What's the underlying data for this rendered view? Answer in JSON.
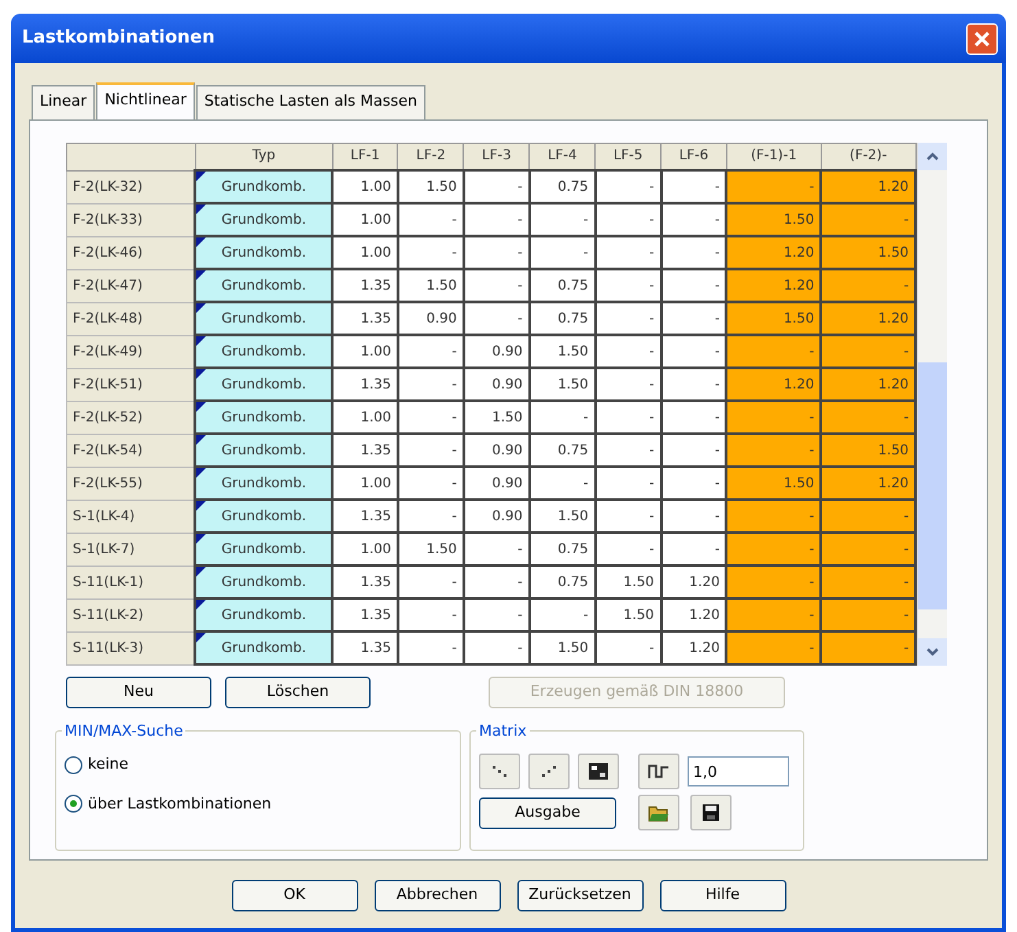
{
  "window": {
    "title": "Lastkombinationen"
  },
  "tabs": [
    {
      "label": "Linear",
      "selected": false
    },
    {
      "label": "Nichtlinear",
      "selected": true
    },
    {
      "label": "Statische Lasten als Massen",
      "selected": false
    }
  ],
  "table": {
    "columns": [
      {
        "kind": "name"
      },
      {
        "label": "Typ",
        "kind": "type"
      },
      {
        "label": "LF-1",
        "kind": "value"
      },
      {
        "label": "LF-2",
        "kind": "value"
      },
      {
        "label": "LF-3",
        "kind": "value"
      },
      {
        "label": "LF-4",
        "kind": "value"
      },
      {
        "label": "LF-5",
        "kind": "value"
      },
      {
        "label": "LF-6",
        "kind": "value"
      },
      {
        "label": "(F-1)-1",
        "kind": "highlight"
      },
      {
        "label": "(F-2)-",
        "kind": "highlight"
      }
    ],
    "rows": [
      {
        "cells": [
          "F-2(LK-32)",
          "Grundkomb.",
          "1.00",
          "1.50",
          "-",
          "0.75",
          "-",
          "-",
          "-",
          "1.20"
        ]
      },
      {
        "cells": [
          "F-2(LK-33)",
          "Grundkomb.",
          "1.00",
          "-",
          "-",
          "-",
          "-",
          "-",
          "1.50",
          "-"
        ]
      },
      {
        "cells": [
          "F-2(LK-46)",
          "Grundkomb.",
          "1.00",
          "-",
          "-",
          "-",
          "-",
          "-",
          "1.20",
          "1.50"
        ]
      },
      {
        "cells": [
          "F-2(LK-47)",
          "Grundkomb.",
          "1.35",
          "1.50",
          "-",
          "0.75",
          "-",
          "-",
          "1.20",
          "-"
        ]
      },
      {
        "cells": [
          "F-2(LK-48)",
          "Grundkomb.",
          "1.35",
          "0.90",
          "-",
          "0.75",
          "-",
          "-",
          "1.50",
          "1.20"
        ]
      },
      {
        "cells": [
          "F-2(LK-49)",
          "Grundkomb.",
          "1.00",
          "-",
          "0.90",
          "1.50",
          "-",
          "-",
          "-",
          "-"
        ]
      },
      {
        "cells": [
          "F-2(LK-51)",
          "Grundkomb.",
          "1.35",
          "-",
          "0.90",
          "1.50",
          "-",
          "-",
          "1.20",
          "1.20"
        ]
      },
      {
        "cells": [
          "F-2(LK-52)",
          "Grundkomb.",
          "1.00",
          "-",
          "1.50",
          "-",
          "-",
          "-",
          "-",
          "-"
        ]
      },
      {
        "cells": [
          "F-2(LK-54)",
          "Grundkomb.",
          "1.35",
          "-",
          "0.90",
          "0.75",
          "-",
          "-",
          "-",
          "1.50"
        ]
      },
      {
        "cells": [
          "F-2(LK-55)",
          "Grundkomb.",
          "1.00",
          "-",
          "0.90",
          "-",
          "-",
          "-",
          "1.50",
          "1.20"
        ]
      },
      {
        "cells": [
          "S-1(LK-4)",
          "Grundkomb.",
          "1.35",
          "-",
          "0.90",
          "1.50",
          "-",
          "-",
          "-",
          "-"
        ]
      },
      {
        "cells": [
          "S-1(LK-7)",
          "Grundkomb.",
          "1.00",
          "1.50",
          "-",
          "0.75",
          "-",
          "-",
          "-",
          "-"
        ]
      },
      {
        "cells": [
          "S-11(LK-1)",
          "Grundkomb.",
          "1.35",
          "-",
          "-",
          "0.75",
          "1.50",
          "1.20",
          "-",
          "-"
        ]
      },
      {
        "cells": [
          "S-11(LK-2)",
          "Grundkomb.",
          "1.35",
          "-",
          "-",
          "-",
          "1.50",
          "1.20",
          "-",
          "-"
        ]
      },
      {
        "cells": [
          "S-11(LK-3)",
          "Grundkomb.",
          "1.35",
          "-",
          "-",
          "1.50",
          "-",
          "1.20",
          "-",
          "-"
        ]
      }
    ]
  },
  "table_buttons": [
    {
      "label": "Neu",
      "disabled": false
    },
    {
      "label": "Löschen",
      "disabled": false
    },
    {
      "label": "Erzeugen gemäß DIN 18800",
      "disabled": true
    }
  ],
  "minmax": {
    "title": "MIN/MAX-Suche",
    "options": [
      {
        "label": "keine",
        "selected": false
      },
      {
        "label": "über Lastkombinationen",
        "selected": true
      }
    ]
  },
  "matrix": {
    "title": "Matrix",
    "factor": "1,0",
    "output_button": "Ausgabe"
  },
  "buttons": [
    "OK",
    "Abbrechen",
    "Zurücksetzen",
    "Hilfe"
  ]
}
